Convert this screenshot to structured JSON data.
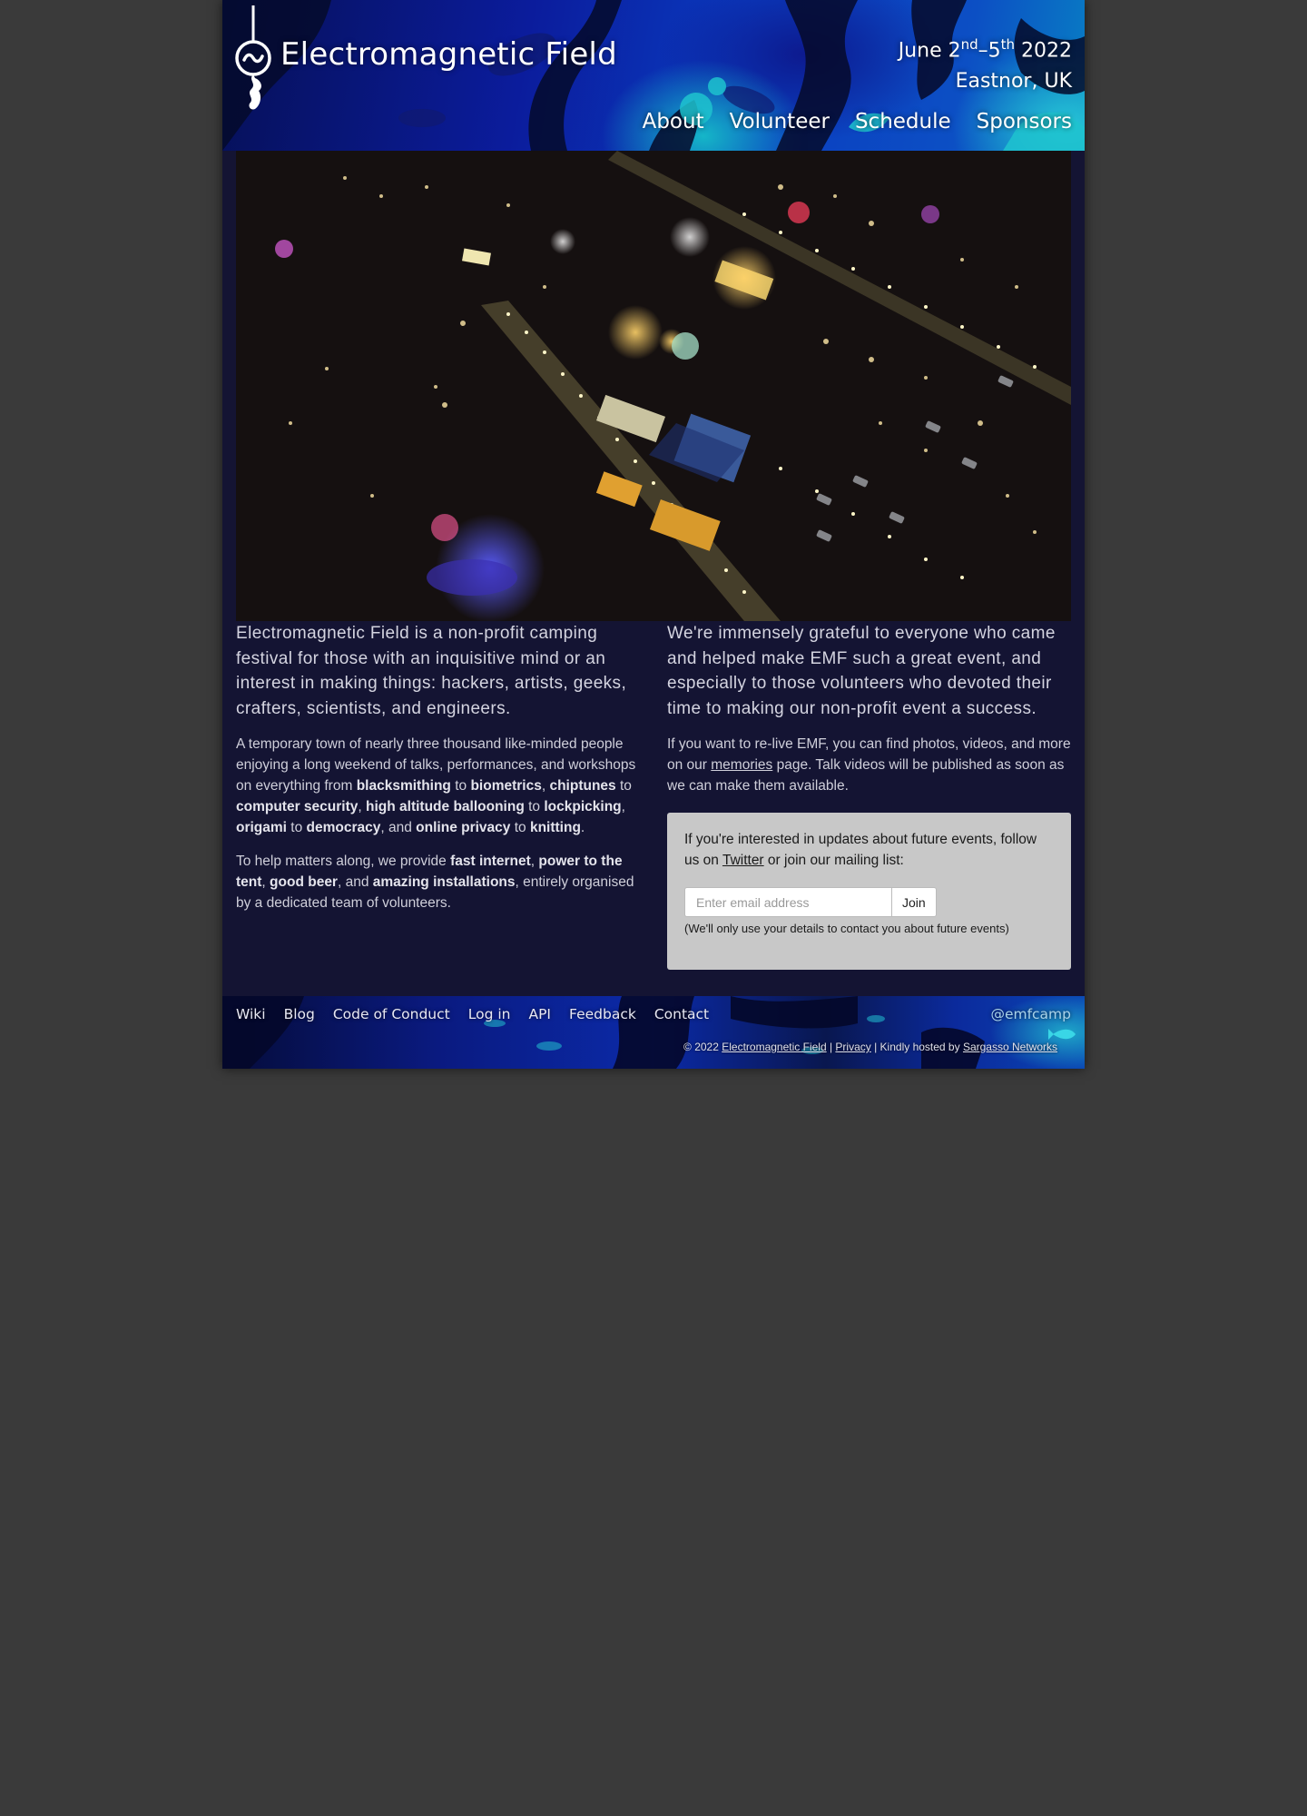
{
  "header": {
    "site_title": "Electromagnetic Field",
    "date_prefix": "June 2",
    "date_sup1": "nd",
    "date_mid": "–5",
    "date_sup2": "th",
    "date_year": " 2022",
    "location": "Eastnor, UK",
    "nav": [
      "About",
      "Volunteer",
      "Schedule",
      "Sponsors"
    ]
  },
  "left": {
    "lead": "Electromagnetic Field is a non-profit camping festival for those with an inquisitive mind or an interest in making things: hackers, artists, geeks, crafters, scientists, and engineers.",
    "p1": {
      "t1": "A temporary town of nearly three thousand like-minded people enjoying a long weekend of talks, performances, and workshops on everything from ",
      "b1": "blacksmithing",
      "t2": " to ",
      "b2": "biometrics",
      "t3": ", ",
      "b3": "chiptunes",
      "t4": " to ",
      "b4": "computer security",
      "t5": ", ",
      "b5": "high altitude ballooning",
      "t6": " to ",
      "b6": "lockpicking",
      "t7": ", ",
      "b7": "origami",
      "t8": " to ",
      "b8": "democracy",
      "t9": ", and ",
      "b9": "online privacy",
      "t10": " to ",
      "b10": "knitting",
      "t11": "."
    },
    "p2": {
      "t1": "To help matters along, we provide ",
      "b1": "fast internet",
      "t2": ", ",
      "b2": "power to the tent",
      "t3": ", ",
      "b3": "good beer",
      "t4": ", and ",
      "b4": "amazing installations",
      "t5": ", entirely organised by a dedicated team of volunteers."
    }
  },
  "right": {
    "lead": "We're immensely grateful to everyone who came and helped make EMF such a great event, and especially to those volunteers who devoted their time to making our non-profit event a success.",
    "p1": {
      "t1": "If you want to re-live EMF, you can find photos, videos, and more on our ",
      "link": "memories",
      "t2": " page. Talk videos will be published as soon as we can make them available."
    },
    "signup": {
      "t1": "If you're interested in updates about future events, follow us on ",
      "link": "Twitter",
      "t2": " or join our mailing list:",
      "placeholder": "Enter email address",
      "button": "Join",
      "note": "(We'll only use your details to contact you about future events)"
    }
  },
  "footer": {
    "links": [
      "Wiki",
      "Blog",
      "Code of Conduct",
      "Log in",
      "API",
      "Feedback",
      "Contact"
    ],
    "twitter": "@emfcamp",
    "copy_prefix": "© 2022 ",
    "copy_org": "Electromagnetic Field",
    "sep1": " | ",
    "privacy": "Privacy",
    "hosted_text": " | Kindly hosted by ",
    "host": "Sargasso Networks"
  },
  "colors": {
    "page_bg": "#3a3a3a",
    "content_bg": "#141433",
    "signup_bg": "#c8c8c8",
    "header_accent": "#27c6d6"
  },
  "icons": {
    "logo": "emf-seahorse-logo",
    "hero": "festival-aerial-night-photo"
  }
}
